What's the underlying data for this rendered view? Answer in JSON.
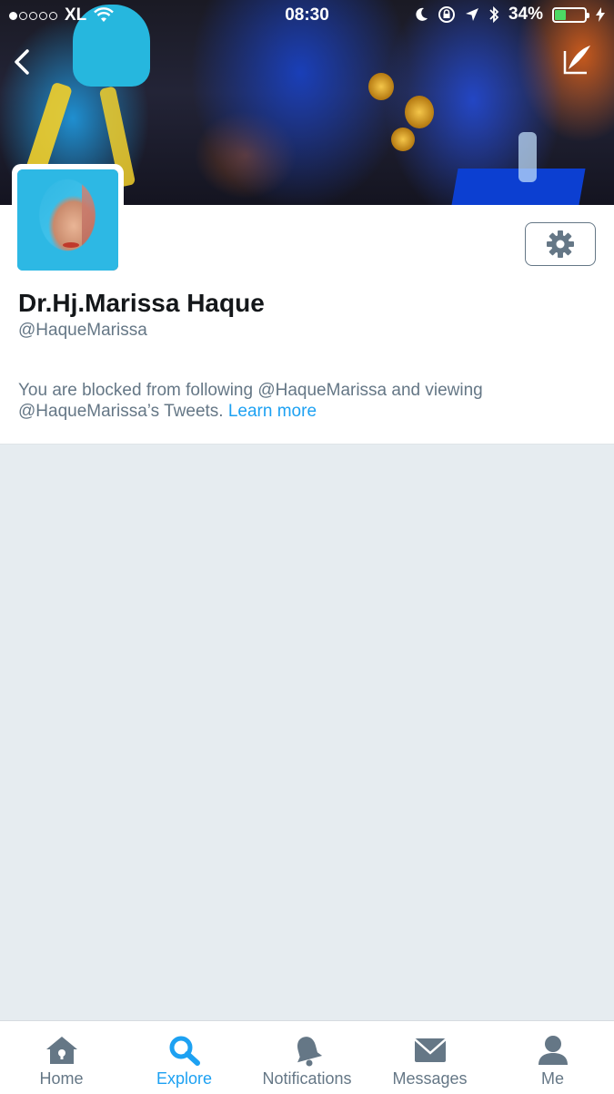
{
  "status_bar": {
    "carrier": "XL",
    "time": "08:30",
    "battery": "34%",
    "battery_level": 0.34
  },
  "header": {
    "back_icon": "chevron-left-icon",
    "compose_icon": "compose-tweet-icon"
  },
  "profile": {
    "name": "Dr.Hj.Marissa Haque",
    "handle": "@HaqueMarissa",
    "blocked_message": "You are blocked from following @HaqueMarissa and viewing @HaqueMarissa’s Tweets.",
    "learn_more": "Learn more",
    "settings_icon": "gear-icon"
  },
  "tabs": [
    {
      "label": "Home",
      "icon": "home-icon"
    },
    {
      "label": "Explore",
      "icon": "search-icon",
      "active": true
    },
    {
      "label": "Notifications",
      "icon": "bell-icon"
    },
    {
      "label": "Messages",
      "icon": "envelope-icon"
    },
    {
      "label": "Me",
      "icon": "person-icon"
    }
  ],
  "colors": {
    "accent": "#1da1f2",
    "text_primary": "#14171a",
    "text_secondary": "#657786",
    "background": "#e6ecf0"
  }
}
